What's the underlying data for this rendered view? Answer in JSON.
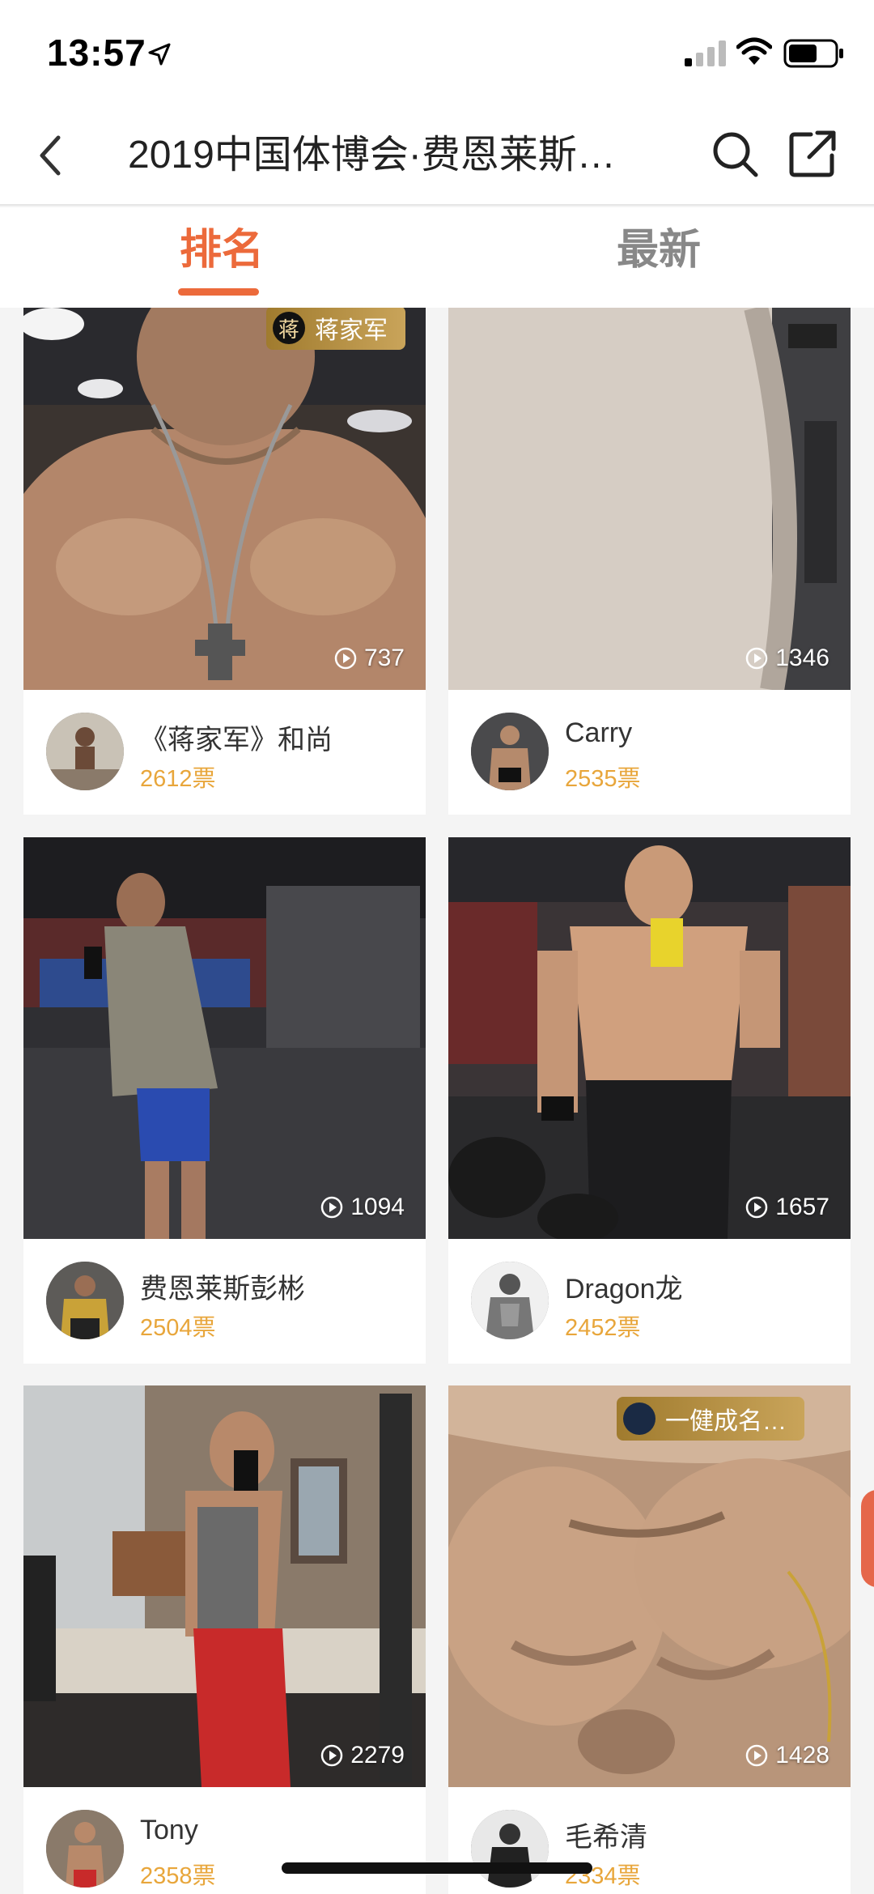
{
  "status_bar": {
    "time": "13:57"
  },
  "nav": {
    "title": "2019中国体博会·费恩莱斯…"
  },
  "tabs": [
    {
      "label": "排名",
      "active": true
    },
    {
      "label": "最新",
      "active": false
    }
  ],
  "accent_color": "#ec6a3b",
  "vote_color": "#e8a63b",
  "cards": [
    {
      "name": "《蒋家军》和尚",
      "votes": "2612票",
      "plays": "737",
      "badge": "蒋家军",
      "badge_logo": "蒋"
    },
    {
      "name": "Carry",
      "votes": "2535票",
      "plays": "1346",
      "badge": null
    },
    {
      "name": "费恩莱斯彭彬",
      "votes": "2504票",
      "plays": "1094",
      "badge": null
    },
    {
      "name": "Dragon龙",
      "votes": "2452票",
      "plays": "1657",
      "badge": null
    },
    {
      "name": "Tony",
      "votes": "2358票",
      "plays": "2279",
      "badge": null
    },
    {
      "name": "毛希清",
      "votes": "2334票",
      "plays": "1428",
      "badge": "一健成名…"
    }
  ]
}
